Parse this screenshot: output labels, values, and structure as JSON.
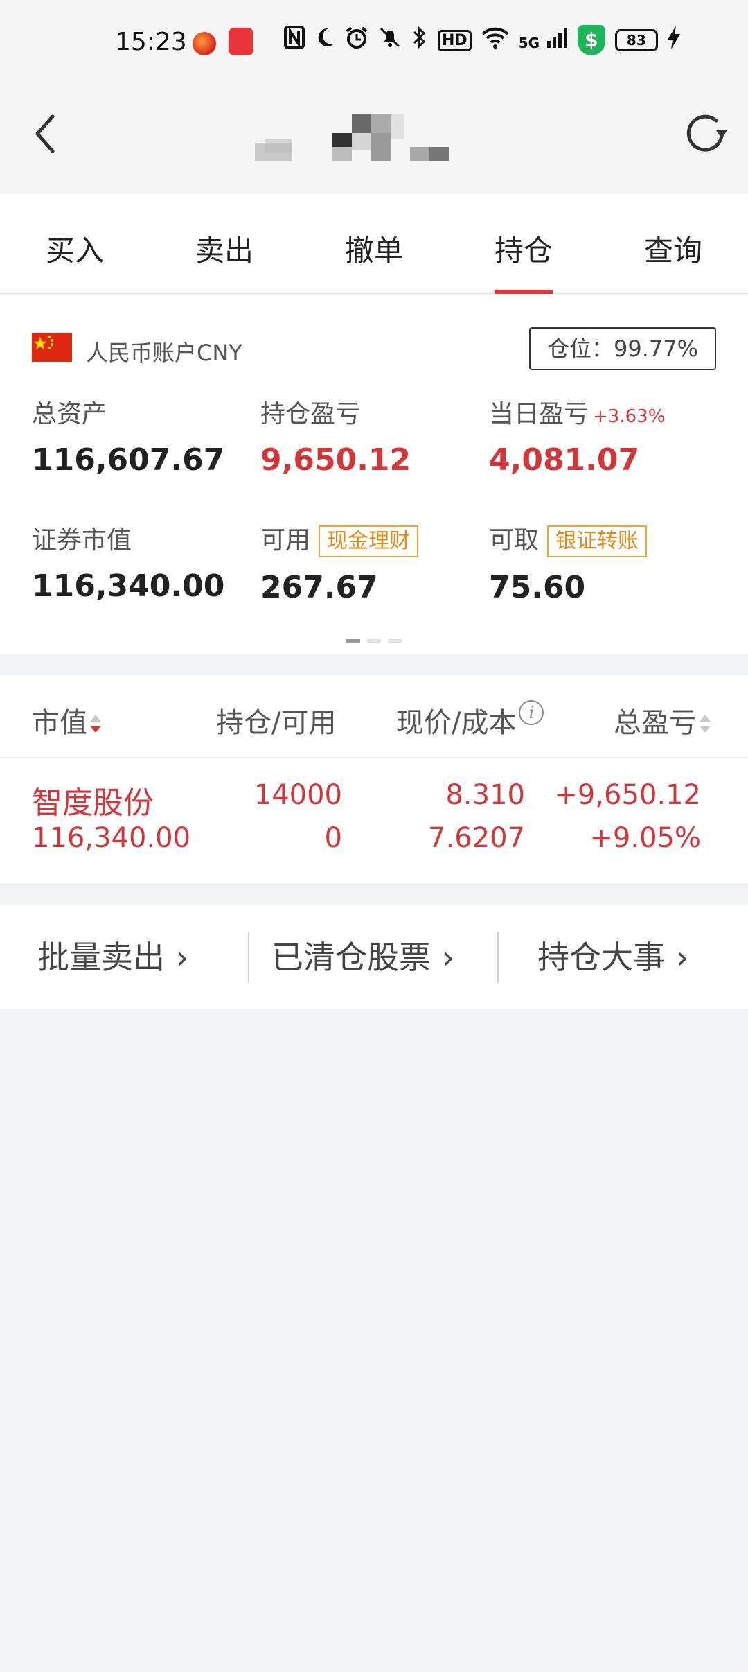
{
  "status_bar": {
    "time": "15:23",
    "battery": "83",
    "icons": [
      "nfc-icon",
      "moon-icon",
      "alarm-icon",
      "mute-icon",
      "bluetooth-icon",
      "hd-icon",
      "wifi-icon",
      "5g-signal-icon",
      "shield-icon",
      "battery-icon",
      "charging-icon"
    ],
    "hd_label": "HD",
    "net_label": "5G"
  },
  "nav": {
    "back_icon": "chevron-left-icon",
    "refresh_icon": "refresh-icon"
  },
  "tabs": [
    {
      "label": "买入",
      "active": false
    },
    {
      "label": "卖出",
      "active": false
    },
    {
      "label": "撤单",
      "active": false
    },
    {
      "label": "持仓",
      "active": true
    },
    {
      "label": "查询",
      "active": false
    }
  ],
  "account": {
    "label": "人民币账户CNY",
    "position_label": "仓位：99.77%",
    "total_assets_label": "总资产",
    "total_assets": "116,607.67",
    "holding_pl_label": "持仓盈亏",
    "holding_pl": "9,650.12",
    "daily_pl_label": "当日盈亏",
    "daily_pl_pct": "+3.63%",
    "daily_pl": "4,081.07",
    "market_value_label": "证券市值",
    "market_value": "116,340.00",
    "available_label": "可用",
    "cash_mgmt_btn": "现金理财",
    "available": "267.67",
    "withdrawable_label": "可取",
    "transfer_btn": "银证转账",
    "withdrawable": "75.60"
  },
  "holdings": {
    "headers": {
      "market_value": "市值",
      "position": "持仓/可用",
      "price": "现价/成本",
      "total_pl": "总盈亏"
    },
    "rows": [
      {
        "name": "智度股份",
        "market_value": "116,340.00",
        "quantity": "14000",
        "available": "0",
        "price": "8.310",
        "cost": "7.6207",
        "pl": "+9,650.12",
        "pl_pct": "+9.05%"
      }
    ]
  },
  "links": {
    "batch_sell": "批量卖出",
    "cleared_stocks": "已清仓股票",
    "holding_events": "持仓大事"
  },
  "colors": {
    "accent_red": "#d3363a",
    "tag_orange": "#e08a1a",
    "background": "#f2f3f5"
  }
}
